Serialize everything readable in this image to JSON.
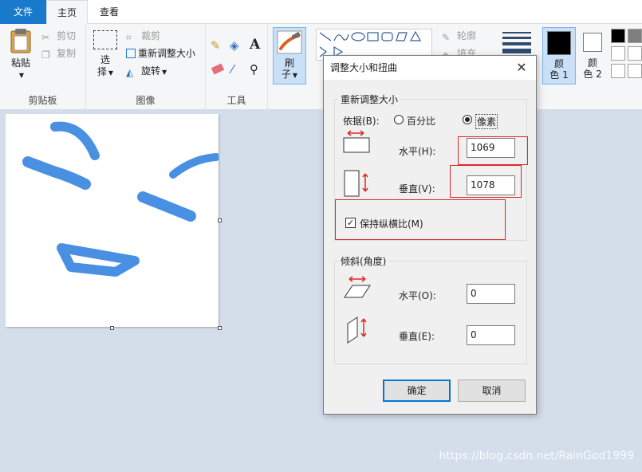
{
  "tabs": {
    "file": "文件",
    "home": "主页",
    "view": "查看"
  },
  "clipboard": {
    "paste": "粘贴",
    "cut": "剪切",
    "copy": "复制",
    "label": "剪贴板"
  },
  "image": {
    "select_1": "选",
    "select_2": "择",
    "crop": "裁剪",
    "resize": "重新调整大小",
    "rotate": "旋转",
    "label": "图像"
  },
  "tools": {
    "label": "工具"
  },
  "brush": {
    "label_1": "刷",
    "label_2": "子"
  },
  "shapes": {
    "outline": "轮廓",
    "fill": "填充"
  },
  "colors": {
    "color1_a": "颜",
    "color1_b": "色 1",
    "color2_a": "颜",
    "color2_b": "色 2",
    "color1": "#000000",
    "color2": "#ffffff",
    "accent": "#1979ca",
    "stroke": "#4a90e2"
  },
  "dialog": {
    "title": "调整大小和扭曲",
    "resize_legend": "重新调整大小",
    "basis_label": "依据(B):",
    "percent_label": "百分比",
    "pixels_label": "像素",
    "horizontal_label": "水平(H):",
    "horizontal_value": "1069",
    "vertical_label": "垂直(V):",
    "vertical_value": "1078",
    "keep_ratio_label": "保持纵横比(M)",
    "keep_ratio_checked": true,
    "skew_legend": "倾斜(角度)",
    "skew_h_label": "水平(O):",
    "skew_h_value": "0",
    "skew_v_label": "垂直(E):",
    "skew_v_value": "0",
    "ok": "确定",
    "cancel": "取消"
  },
  "watermark": "https://blog.csdn.net/RainGod1999"
}
